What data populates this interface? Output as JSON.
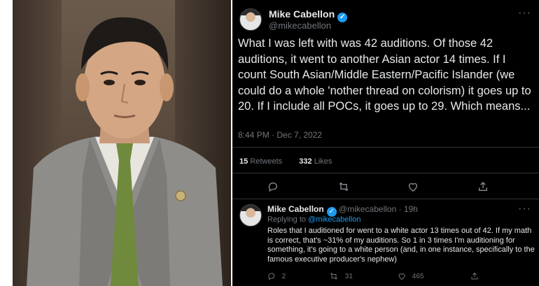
{
  "main_tweet": {
    "author_name": "Mike Cabellon",
    "handle": "@mikecabellon",
    "text": "What I was left with was 42 auditions. Of those 42 auditions, it went to another Asian actor 14 times. If I count South Asian/Middle Eastern/Pacific Islander (we could do a whole 'nother thread on colorism) it goes up to 20. If I include all POCs, it goes up to 29. Which means...",
    "timestamp": "8:44 PM · Dec 7, 2022",
    "retweets_count": "15",
    "retweets_label": "Retweets",
    "likes_count": "332",
    "likes_label": "Likes"
  },
  "reply_tweet": {
    "author_name": "Mike Cabellon",
    "meta": "@mikecabellon · 19h",
    "replying_prefix": "Replying to",
    "replying_to": "@mikecabellon",
    "text": "Roles that I auditioned for went to a white actor 13 times out of 42. If my math is correct, that's ~31% of my auditions. So 1 in 3 times I'm auditioning for something, it's going to a white person (and, in one instance, specifically to the famous executive producer's nephew)",
    "reply_count": "2",
    "retweet_count": "31",
    "like_count": "465"
  },
  "icons": {
    "verified": "verified-badge-icon",
    "more": "more-options-icon",
    "reply": "reply-icon",
    "retweet": "retweet-icon",
    "like": "heart-icon",
    "share": "share-icon"
  },
  "colors": {
    "background": "#000000",
    "text": "#e7e9ea",
    "secondary_text": "#71767b",
    "accent": "#1d9bf0",
    "divider": "#2f3336"
  }
}
